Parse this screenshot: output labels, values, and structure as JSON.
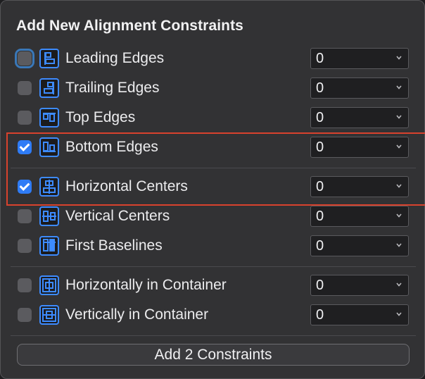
{
  "title": "Add New Alignment Constraints",
  "constraints": [
    {
      "label": "Leading Edges",
      "value": "0",
      "checked": false,
      "icon": "leading-edges-icon"
    },
    {
      "label": "Trailing Edges",
      "value": "0",
      "checked": false,
      "icon": "trailing-edges-icon"
    },
    {
      "label": "Top Edges",
      "value": "0",
      "checked": false,
      "icon": "top-edges-icon"
    },
    {
      "label": "Bottom Edges",
      "value": "0",
      "checked": true,
      "icon": "bottom-edges-icon"
    },
    {
      "label": "Horizontal Centers",
      "value": "0",
      "checked": true,
      "icon": "horizontal-centers-icon"
    },
    {
      "label": "Vertical Centers",
      "value": "0",
      "checked": false,
      "icon": "vertical-centers-icon"
    },
    {
      "label": "First Baselines",
      "value": "0",
      "checked": false,
      "icon": "first-baselines-icon"
    },
    {
      "label": "Horizontally in Container",
      "value": "0",
      "checked": false,
      "icon": "horizontally-in-container-icon"
    },
    {
      "label": "Vertically in Container",
      "value": "0",
      "checked": false,
      "icon": "vertically-in-container-icon"
    }
  ],
  "add_button_label": "Add 2 Constraints",
  "colors": {
    "accent": "#2f7cf6",
    "highlight_border": "#d8422d",
    "icon_blue": "#3d8bff"
  }
}
